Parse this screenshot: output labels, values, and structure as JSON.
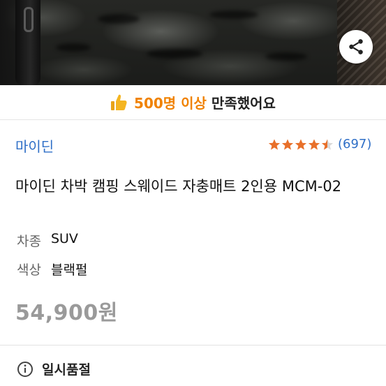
{
  "share": {
    "icon": "share-icon"
  },
  "satisfaction": {
    "icon": "thumbs-up-icon",
    "highlight": "500명 이상",
    "rest": " 만족했어요",
    "highlight_color": "#f08200"
  },
  "product": {
    "brand": "마이딘",
    "rating": {
      "value": 4.5,
      "max": 5,
      "count_text": "(697)",
      "star_color": "#e8702a"
    },
    "title": "마이딘 차박 캠핑 스웨이드 자충매트 2인용 MCM-02",
    "options": [
      {
        "label": "차종",
        "value": "SUV"
      },
      {
        "label": "색상",
        "value": "블랙펄"
      }
    ],
    "price": "54,900원",
    "status": {
      "icon": "info-icon",
      "text": "일시품절"
    }
  },
  "colors": {
    "brand_link": "#2f6fc7",
    "price_gray": "#9a9a9a"
  }
}
